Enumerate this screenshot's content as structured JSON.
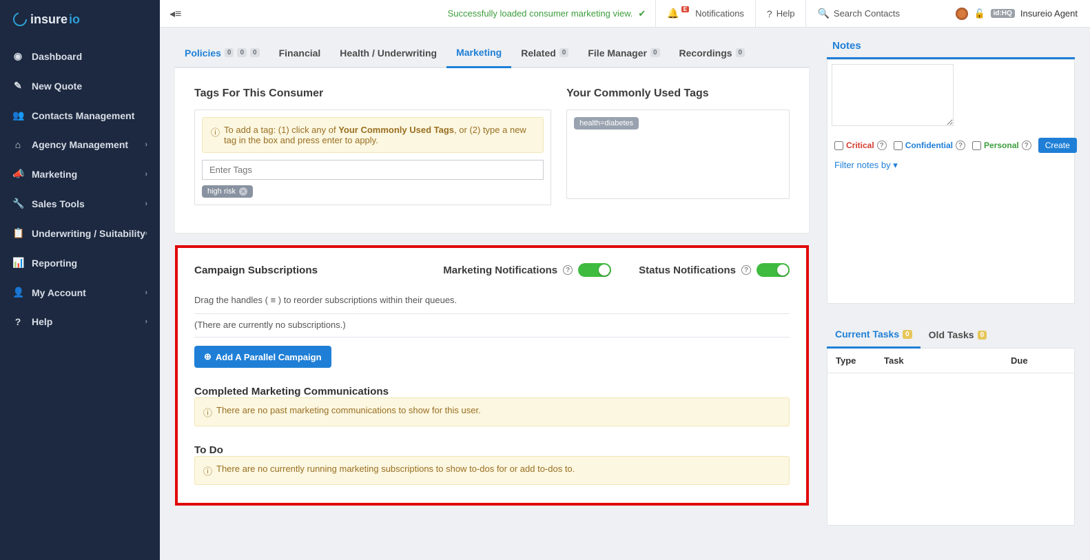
{
  "brand": {
    "name": "insureio"
  },
  "sidebar": {
    "items": [
      {
        "label": "Dashboard",
        "chev": false
      },
      {
        "label": "New Quote",
        "chev": false
      },
      {
        "label": "Contacts Management",
        "chev": false
      },
      {
        "label": "Agency Management",
        "chev": true
      },
      {
        "label": "Marketing",
        "chev": true
      },
      {
        "label": "Sales Tools",
        "chev": true
      },
      {
        "label": "Underwriting / Suitability",
        "chev": true
      },
      {
        "label": "Reporting",
        "chev": false
      },
      {
        "label": "My Account",
        "chev": true
      },
      {
        "label": "Help",
        "chev": true
      }
    ]
  },
  "topbar": {
    "flash": "Successfully loaded consumer marketing view.",
    "notif_badge": "E",
    "notif_label": "Notifications",
    "help_label": "Help",
    "search_label": "Search Contacts",
    "id_tag": "id:HQ",
    "username": "Insureio Agent"
  },
  "tabs": {
    "policies": "Policies",
    "policy_counts": [
      "0",
      "0",
      "0"
    ],
    "financial": "Financial",
    "health": "Health / Underwriting",
    "marketing": "Marketing",
    "related": "Related",
    "related_count": "0",
    "filemgr": "File Manager",
    "filemgr_count": "0",
    "recordings": "Recordings",
    "recordings_count": "0"
  },
  "tags": {
    "heading": "Tags For This Consumer",
    "help_pre": "To add a tag: (1) click any of ",
    "help_bold": "Your Commonly Used Tags",
    "help_post": ", or (2) type a new tag in the box and press enter to apply.",
    "placeholder": "Enter Tags",
    "current": [
      "high risk"
    ],
    "common_head": "Your Commonly Used Tags",
    "common": [
      "health=diabetes"
    ]
  },
  "campaign": {
    "heading": "Campaign Subscriptions",
    "mkt_label": "Marketing Notifications",
    "status_label": "Status Notifications",
    "reorder_text": "Drag the handles ( ≡ ) to reorder subscriptions within their queues.",
    "none_text": "(There are currently no subscriptions.)",
    "add_label": "Add A Parallel Campaign"
  },
  "completed": {
    "heading": "Completed Marketing Communications",
    "empty": "There are no past marketing communications to show for this user."
  },
  "todo": {
    "heading": "To Do",
    "empty": "There are no currently running marketing subscriptions to show to-dos for or add to-dos to."
  },
  "notes": {
    "tab": "Notes",
    "critical": "Critical",
    "confidential": "Confidential",
    "personal": "Personal",
    "create": "Create",
    "filter": "Filter notes by"
  },
  "tasks": {
    "current": "Current Tasks",
    "current_count": "0",
    "old": "Old Tasks",
    "old_count": "0",
    "col_type": "Type",
    "col_task": "Task",
    "col_due": "Due"
  }
}
